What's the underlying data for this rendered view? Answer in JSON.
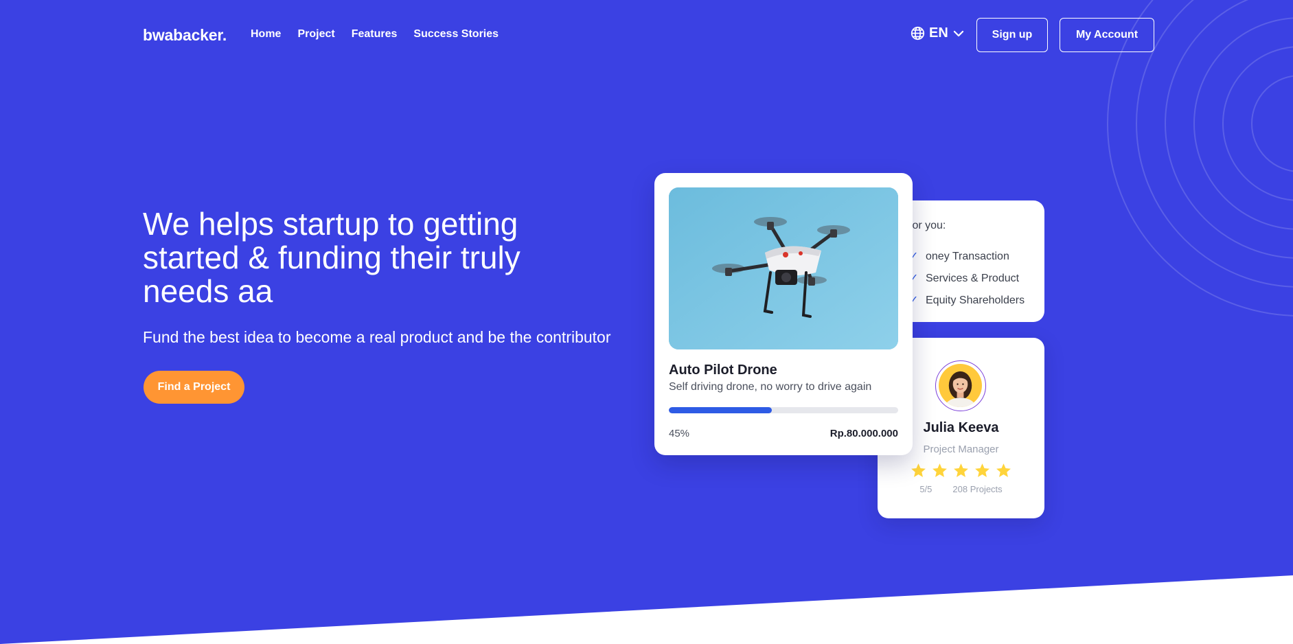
{
  "brand": {
    "name": "bwabacker."
  },
  "nav": {
    "items": [
      {
        "label": "Home"
      },
      {
        "label": "Project"
      },
      {
        "label": "Features"
      },
      {
        "label": "Success Stories"
      }
    ],
    "language": "EN",
    "signup_label": "Sign up",
    "account_label": "My Account"
  },
  "hero": {
    "title": "We helps startup to getting started & funding their truly needs aa",
    "subtitle": "Fund the best idea to become a real product and be the contributor",
    "cta_label": "Find a Project"
  },
  "benefit_card": {
    "heading": "for you:",
    "items": [
      "oney Transaction",
      "Services & Product",
      "Equity Shareholders"
    ]
  },
  "project_card": {
    "title": "Auto Pilot Drone",
    "description": "Self driving drone, no worry to drive again",
    "progress_percent": 45,
    "progress_label": "45%",
    "amount": "Rp.80.000.000",
    "progress_color": "#2E5BE5"
  },
  "profile_card": {
    "name": "Julia Keeva",
    "role": "Project Manager",
    "rating_stars": 5,
    "rating_label": "5/5",
    "projects_label": "208 Projects",
    "star_color": "#FFD43B"
  },
  "colors": {
    "background": "#3B41E3",
    "cta": "#FF9533",
    "card": "#FFFFFF"
  },
  "icons": {
    "language": "globe-icon",
    "language_toggle": "chevron-down-icon",
    "rating": "star-icon",
    "benefit": "check-icon"
  }
}
